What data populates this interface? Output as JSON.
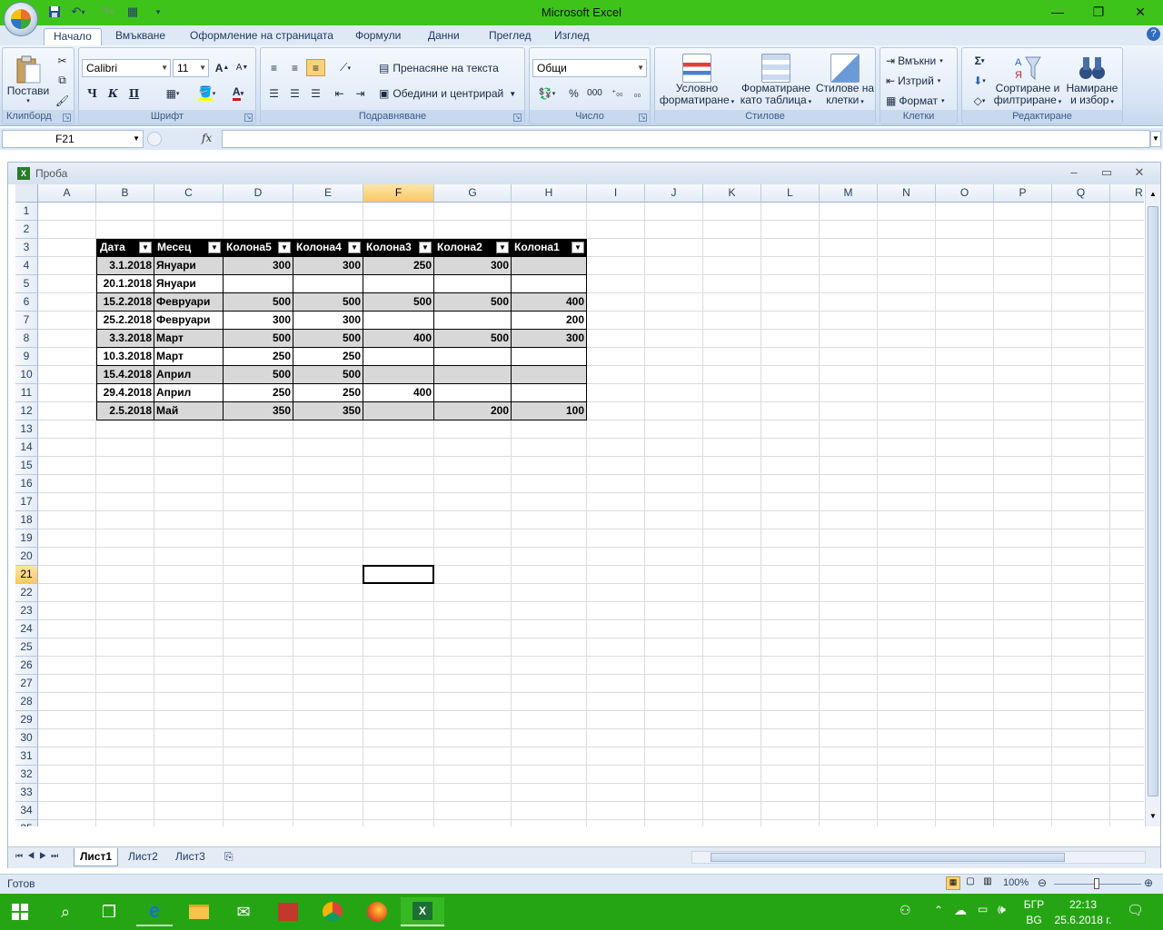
{
  "app": {
    "title": "Microsoft Excel"
  },
  "colors": {
    "titlebar": "#3ec31a",
    "taskbar": "#26a514",
    "table_header": "#000000",
    "table_band": "#d8d8d8"
  },
  "quick_access": [
    "save-icon",
    "undo-icon",
    "redo-icon",
    "customize-icon"
  ],
  "tabs": [
    "Начало",
    "Вмъкване",
    "Оформление на страницата",
    "Формули",
    "Данни",
    "Преглед",
    "Изглед"
  ],
  "ribbon": {
    "clipboard": {
      "label": "Клипборд",
      "paste": "Постави"
    },
    "font": {
      "label": "Шрифт",
      "name": "Calibri",
      "size": "11",
      "bold": "Ч",
      "italic": "К",
      "underline": "П"
    },
    "alignment": {
      "label": "Подравняване",
      "wrap": "Пренасяне на текста",
      "merge": "Обедини и центрирай"
    },
    "number": {
      "label": "Число",
      "format": "Общи"
    },
    "styles": {
      "label": "Стилове",
      "conditional": [
        "Условно",
        "форматиране"
      ],
      "as_table": [
        "Форматиране",
        "като таблица"
      ],
      "cell_styles": [
        "Стилове на",
        "клетки"
      ]
    },
    "cells": {
      "label": "Клетки",
      "insert": "Вмъкни",
      "delete": "Изтрий",
      "format": "Формат"
    },
    "editing": {
      "label": "Редактиране",
      "sort": [
        "Сортиране и",
        "филтриране"
      ],
      "find": [
        "Намиране",
        "и избор"
      ]
    }
  },
  "formula": {
    "namebox": "F21",
    "fx": "fx",
    "value": ""
  },
  "workbook": {
    "title": "Проба"
  },
  "columns": [
    "A",
    "B",
    "C",
    "D",
    "E",
    "F",
    "G",
    "H",
    "I",
    "J",
    "K",
    "L",
    "M",
    "N",
    "O",
    "P",
    "Q",
    "R"
  ],
  "rows": [
    "1",
    "2",
    "3",
    "4",
    "5",
    "6",
    "7",
    "8",
    "9",
    "10",
    "11",
    "12",
    "13",
    "14",
    "15",
    "16",
    "17",
    "18",
    "19",
    "20",
    "21",
    "22",
    "23",
    "24",
    "25",
    "26",
    "27",
    "28",
    "29",
    "30",
    "31",
    "32",
    "33",
    "34",
    "35"
  ],
  "selected": {
    "column": "F",
    "row": "21"
  },
  "table": {
    "headers": [
      "Дата",
      "Месец",
      "Колона5",
      "Колона4",
      "Колона3",
      "Колона2",
      "Колона1"
    ],
    "rows": [
      [
        "3.1.2018",
        "Януари",
        "300",
        "300",
        "250",
        "300",
        ""
      ],
      [
        "20.1.2018",
        "Януари",
        "",
        "",
        "",
        "",
        ""
      ],
      [
        "15.2.2018",
        "Февруари",
        "500",
        "500",
        "500",
        "500",
        "400"
      ],
      [
        "25.2.2018",
        "Февруари",
        "300",
        "300",
        "",
        "",
        "200"
      ],
      [
        "3.3.2018",
        "Март",
        "500",
        "500",
        "400",
        "500",
        "300"
      ],
      [
        "10.3.2018",
        "Март",
        "250",
        "250",
        "",
        "",
        ""
      ],
      [
        "15.4.2018",
        "Април",
        "500",
        "500",
        "",
        "",
        ""
      ],
      [
        "29.4.2018",
        "Април",
        "250",
        "250",
        "400",
        "",
        ""
      ],
      [
        "2.5.2018",
        "Май",
        "350",
        "350",
        "",
        "200",
        "100"
      ]
    ]
  },
  "sheets": [
    "Лист1",
    "Лист2",
    "Лист3"
  ],
  "status": {
    "ready": "Готов",
    "zoom": "100%"
  },
  "tray": {
    "lang1": "БГР",
    "lang2": "BG",
    "time": "22:13",
    "date": "25.6.2018 г."
  }
}
